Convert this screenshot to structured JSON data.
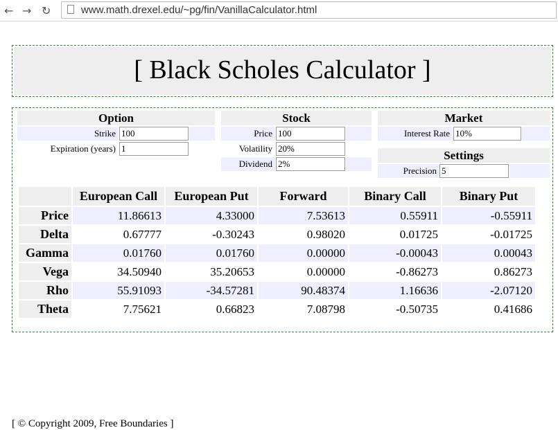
{
  "browser": {
    "back_icon": "back-arrow-icon",
    "forward_icon": "forward-arrow-icon",
    "reload_icon": "reload-icon",
    "url": "www.math.drexel.edu/~pg/fin/VanillaCalculator.html"
  },
  "title": "[ Black Scholes Calculator ]",
  "option": {
    "header": "Option",
    "strike_label": "Strike",
    "strike_value": "100",
    "expiration_label": "Expiration (years)",
    "expiration_value": "1"
  },
  "stock": {
    "header": "Stock",
    "price_label": "Price",
    "price_value": "100",
    "volatility_label": "Volatility",
    "volatility_value": "20%",
    "dividend_label": "Dividend",
    "dividend_value": "2%"
  },
  "market": {
    "header": "Market",
    "interest_label": "Interest Rate",
    "interest_value": "10%"
  },
  "settings": {
    "header": "Settings",
    "precision_label": "Precision",
    "precision_value": "5"
  },
  "results": {
    "columns": [
      "European Call",
      "European Put",
      "Forward",
      "Binary Call",
      "Binary Put"
    ],
    "rows": [
      {
        "label": "Price",
        "values": [
          "11.86613",
          "4.33000",
          "7.53613",
          "0.55911",
          "-0.55911"
        ]
      },
      {
        "label": "Delta",
        "values": [
          "0.67777",
          "-0.30243",
          "0.98020",
          "0.01725",
          "-0.01725"
        ]
      },
      {
        "label": "Gamma",
        "values": [
          "0.01760",
          "0.01760",
          "0.00000",
          "-0.00043",
          "0.00043"
        ]
      },
      {
        "label": "Vega",
        "values": [
          "34.50940",
          "35.20653",
          "0.00000",
          "-0.86273",
          "0.86273"
        ]
      },
      {
        "label": "Rho",
        "values": [
          "55.91093",
          "-34.57281",
          "90.48374",
          "1.16636",
          "-2.07120"
        ]
      },
      {
        "label": "Theta",
        "values": [
          "7.75621",
          "0.66823",
          "7.08798",
          "-0.50735",
          "0.41686"
        ]
      }
    ]
  },
  "footer": "[ © Copyright 2009, Free Boundaries ]"
}
